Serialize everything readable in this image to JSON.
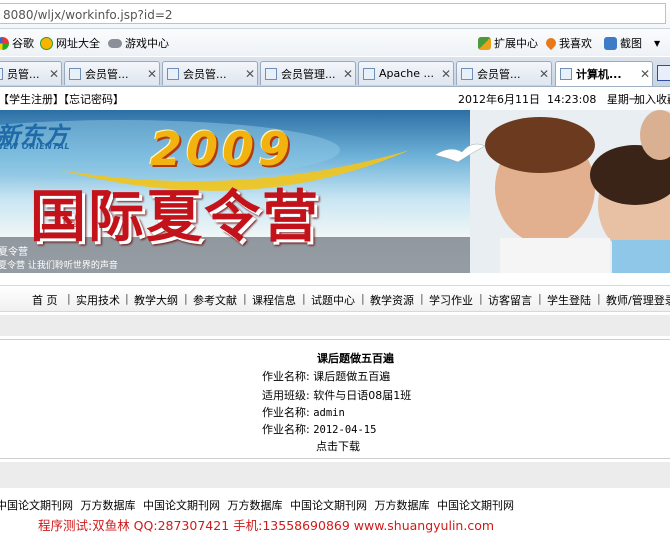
{
  "browser": {
    "url": "8080/wljx/workinfo.jsp?id=2",
    "favorites": [
      {
        "label": "谷歌",
        "icon": "google-icon"
      },
      {
        "label": "网址大全",
        "icon": "globe-icon"
      },
      {
        "label": "游戏中心",
        "icon": "gamepad-icon"
      }
    ],
    "right_tools": [
      {
        "label": "扩展中心",
        "icon": "puzzle-icon"
      },
      {
        "label": "我喜欢",
        "icon": "heart-icon"
      },
      {
        "label": "截图",
        "icon": "scissors-icon"
      }
    ],
    "tabs": [
      {
        "label": "员管..."
      },
      {
        "label": "会员管..."
      },
      {
        "label": "会员管..."
      },
      {
        "label": "会员管理..."
      },
      {
        "label": "Apache ..."
      },
      {
        "label": "会员管..."
      },
      {
        "label": "计算机..."
      }
    ]
  },
  "header": {
    "register": "【学生注册】",
    "forgot": "【忘记密码】",
    "datetime": "2012年6月11日  14:23:08   星期一",
    "bookmark": "加入收藏"
  },
  "banner": {
    "logo_cn": "新东方",
    "logo_en": "NEW ORIENTAL",
    "year": "2009",
    "headline": "国际夏令营",
    "subtitle_1": "夏令营",
    "subtitle_2": "夏令营  让我们聆听世界的声音"
  },
  "nav": [
    "首 页",
    "实用技术",
    "教学大纲",
    "参考文献",
    "课程信息",
    "试题中心",
    "教学资源",
    "学习作业",
    "访客留言",
    "学生登陆",
    "教师/管理登录"
  ],
  "work": {
    "title": "课后题做五百遍",
    "rows": [
      {
        "label": "作业名称:",
        "value": "课后题做五百遍"
      },
      {
        "label": "适用班级:",
        "value": "软件与日语08届1班"
      },
      {
        "label": "作业名称:",
        "value": "admin"
      },
      {
        "label": "作业名称:",
        "value": "2012-04-15"
      }
    ],
    "download": "点击下载"
  },
  "footer": {
    "links": [
      "中国论文期刊网",
      "万方数据库",
      "中国论文期刊网",
      "万方数据库",
      "中国论文期刊网",
      "万方数据库",
      "中国论文期刊网"
    ],
    "credit": "程序测试:双鱼林 QQ:287307421 手机:13558690869 www.shuangyulin.com"
  },
  "colors": {
    "credit": "#d11a1a",
    "headline": "#c4121a",
    "year": "#f2b311"
  }
}
